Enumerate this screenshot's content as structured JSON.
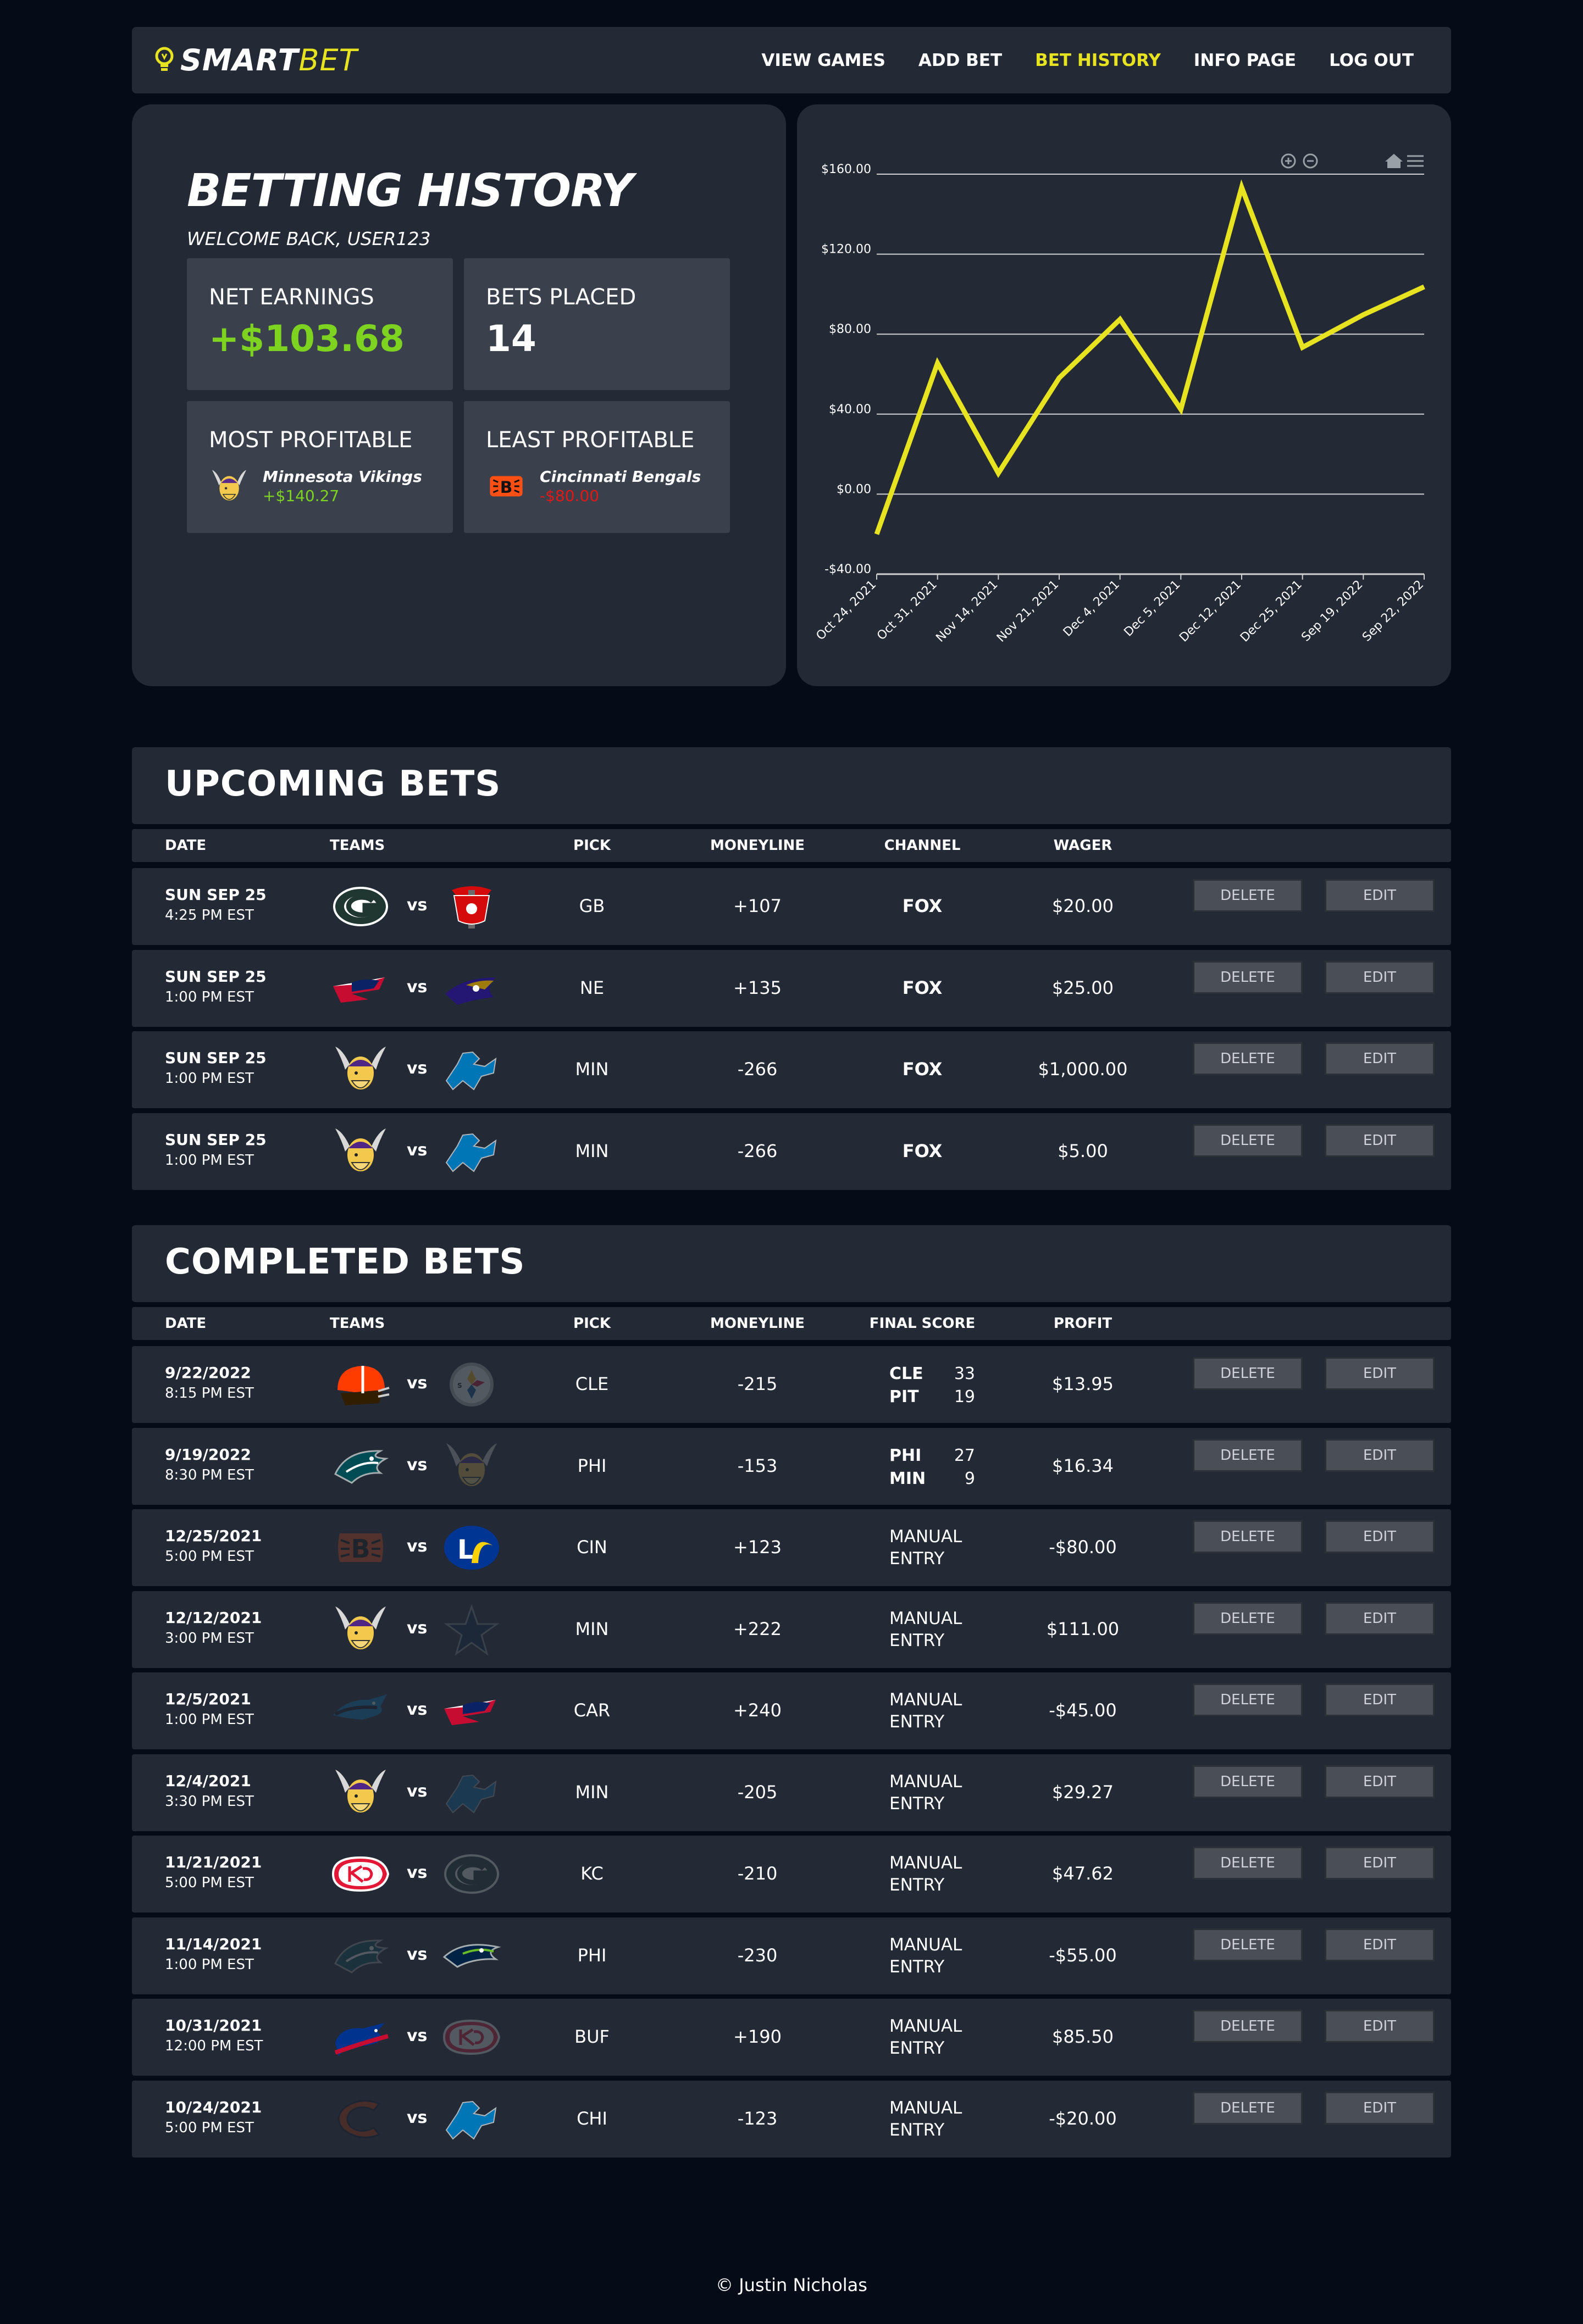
{
  "nav": {
    "logo_smart": "SMART",
    "logo_bet": "BET",
    "links": [
      "VIEW GAMES",
      "ADD BET",
      "BET HISTORY",
      "INFO PAGE",
      "LOG OUT"
    ],
    "active": "BET HISTORY"
  },
  "history": {
    "title": "BETTING HISTORY",
    "welcome": "WELCOME BACK, USER123",
    "net_earnings_label": "NET EARNINGS",
    "net_earnings_value": "+$103.68",
    "bets_placed_label": "BETS PLACED",
    "bets_placed_value": "14",
    "most_profitable_label": "MOST PROFITABLE",
    "most_profitable_team": "Minnesota Vikings",
    "most_profitable_value": "+$140.27",
    "least_profitable_label": "LEAST PROFITABLE",
    "least_profitable_team": "Cincinnati Bengals",
    "least_profitable_value": "-$80.00"
  },
  "chart_data": {
    "type": "line",
    "categories": [
      "Oct 24, 2021",
      "Oct 31, 2021",
      "Nov 14, 2021",
      "Nov 21, 2021",
      "Dec 4, 2021",
      "Dec 5, 2021",
      "Dec 12, 2021",
      "Dec 25, 2021",
      "Sep 19, 2022",
      "Sep 22, 2022"
    ],
    "values": [
      -20.0,
      65.5,
      10.5,
      58.1,
      87.4,
      42.4,
      153.4,
      73.4,
      89.7,
      103.68
    ],
    "y_ticks": [
      "$160.00",
      "$120.00",
      "$80.00",
      "$40.00",
      "$0.00",
      "-$40.00"
    ],
    "ylim": [
      -40,
      160
    ],
    "line_color": "#e8e320",
    "grid": true,
    "toolbar_icons": [
      "zoom-in-icon",
      "zoom-out-icon",
      "home-icon",
      "menu-icon"
    ]
  },
  "upcoming": {
    "title": "UPCOMING BETS",
    "headers": [
      "DATE",
      "TEAMS",
      "PICK",
      "MONEYLINE",
      "CHANNEL",
      "WAGER"
    ],
    "rows": [
      {
        "day": "SUN SEP 25",
        "time": "4:25 PM EST",
        "home": "GB",
        "away": "TB",
        "pick": "GB",
        "moneyline": "+107",
        "channel": "FOX",
        "wager": "$20.00"
      },
      {
        "day": "SUN SEP 25",
        "time": "1:00 PM EST",
        "home": "NE",
        "away": "BAL",
        "pick": "NE",
        "moneyline": "+135",
        "channel": "FOX",
        "wager": "$25.00"
      },
      {
        "day": "SUN SEP 25",
        "time": "1:00 PM EST",
        "home": "MIN",
        "away": "DET",
        "pick": "MIN",
        "moneyline": "-266",
        "channel": "FOX",
        "wager": "$1,000.00"
      },
      {
        "day": "SUN SEP 25",
        "time": "1:00 PM EST",
        "home": "MIN",
        "away": "DET",
        "pick": "MIN",
        "moneyline": "-266",
        "channel": "FOX",
        "wager": "$5.00"
      }
    ]
  },
  "completed": {
    "title": "COMPLETED BETS",
    "headers": [
      "DATE",
      "TEAMS",
      "PICK",
      "MONEYLINE",
      "FINAL SCORE",
      "PROFIT"
    ],
    "rows": [
      {
        "day": "9/22/2022",
        "time": "8:15 PM EST",
        "home": "CLE",
        "away": "PIT",
        "home_dim": false,
        "away_dim": true,
        "pick": "CLE",
        "moneyline": "-215",
        "score": {
          "t1": "CLE",
          "s1": "33",
          "t2": "PIT",
          "s2": "19"
        },
        "profit": "$13.95",
        "profit_pos": true
      },
      {
        "day": "9/19/2022",
        "time": "8:30 PM EST",
        "home": "PHI",
        "away": "MIN",
        "home_dim": false,
        "away_dim": true,
        "pick": "PHI",
        "moneyline": "-153",
        "score": {
          "t1": "PHI",
          "s1": "27",
          "t2": "MIN",
          "s2": "9"
        },
        "profit": "$16.34",
        "profit_pos": true
      },
      {
        "day": "12/25/2021",
        "time": "5:00 PM EST",
        "home": "CIN",
        "away": "LAR",
        "home_dim": true,
        "away_dim": false,
        "pick": "CIN",
        "moneyline": "+123",
        "manual": "MANUAL ENTRY",
        "profit": "-$80.00",
        "profit_pos": false
      },
      {
        "day": "12/12/2021",
        "time": "3:00 PM EST",
        "home": "MIN",
        "away": "DAL",
        "home_dim": false,
        "away_dim": true,
        "pick": "MIN",
        "moneyline": "+222",
        "manual": "MANUAL ENTRY",
        "profit": "$111.00",
        "profit_pos": true
      },
      {
        "day": "12/5/2021",
        "time": "1:00 PM EST",
        "home": "CAR",
        "away": "NE",
        "home_dim": true,
        "away_dim": false,
        "pick": "CAR",
        "moneyline": "+240",
        "manual": "MANUAL ENTRY",
        "profit": "-$45.00",
        "profit_pos": false
      },
      {
        "day": "12/4/2021",
        "time": "3:30 PM EST",
        "home": "MIN",
        "away": "DET",
        "home_dim": false,
        "away_dim": true,
        "pick": "MIN",
        "moneyline": "-205",
        "manual": "MANUAL ENTRY",
        "profit": "$29.27",
        "profit_pos": true
      },
      {
        "day": "11/21/2021",
        "time": "5:00 PM EST",
        "home": "KC",
        "away": "GB",
        "home_dim": false,
        "away_dim": true,
        "pick": "KC",
        "moneyline": "-210",
        "manual": "MANUAL ENTRY",
        "profit": "$47.62",
        "profit_pos": true
      },
      {
        "day": "11/14/2021",
        "time": "1:00 PM EST",
        "home": "PHI",
        "away": "SEA",
        "home_dim": true,
        "away_dim": false,
        "pick": "PHI",
        "moneyline": "-230",
        "manual": "MANUAL ENTRY",
        "profit": "-$55.00",
        "profit_pos": false
      },
      {
        "day": "10/31/2021",
        "time": "12:00 PM EST",
        "home": "BUF",
        "away": "KC",
        "home_dim": false,
        "away_dim": true,
        "pick": "BUF",
        "moneyline": "+190",
        "manual": "MANUAL ENTRY",
        "profit": "$85.50",
        "profit_pos": true
      },
      {
        "day": "10/24/2021",
        "time": "5:00 PM EST",
        "home": "CHI",
        "away": "DET",
        "home_dim": true,
        "away_dim": false,
        "pick": "CHI",
        "moneyline": "-123",
        "manual": "MANUAL ENTRY",
        "profit": "-$20.00",
        "profit_pos": false
      }
    ]
  },
  "buttons": {
    "delete": "DELETE",
    "edit": "EDIT"
  },
  "vs": "vs",
  "footer": "© Justin Nicholas"
}
